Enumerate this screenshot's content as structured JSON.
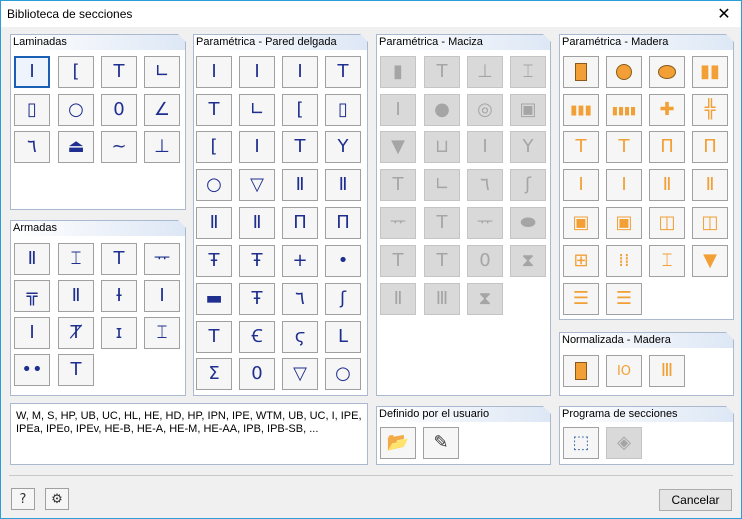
{
  "window": {
    "title": "Biblioteca de secciones",
    "close_icon": "close-icon"
  },
  "groups": {
    "laminadas": {
      "title": "Laminadas"
    },
    "armadas": {
      "title": "Armadas"
    },
    "pared_delgada": {
      "title": "Paramétrica - Pared delgada"
    },
    "maciza": {
      "title": "Paramétrica - Maciza"
    },
    "madera": {
      "title": "Paramétrica - Madera"
    },
    "normalizada": {
      "title": "Normalizada - Madera"
    },
    "definido": {
      "title": "Definido por el usuario"
    },
    "programa": {
      "title": "Programa de secciones"
    }
  },
  "info": {
    "text": "W, M, S, HP, UB, UC, HL, HE, HD, HP, IPN, IPE, WTM, UB, UC, I, IPE, IPEa, IPEo, IPEv, HE-B, HE-A, HE-M, HE-AA, IPB, IPB-SB, ..."
  },
  "footer": {
    "cancel_label": "Cancelar",
    "help_icon": "help-icon",
    "info_icon": "info-icon"
  },
  "colors": {
    "accent": "#2b9ed8",
    "selection": "#1a5fb4",
    "glyph": "#1f2f8f",
    "wood": "#f2a036"
  }
}
